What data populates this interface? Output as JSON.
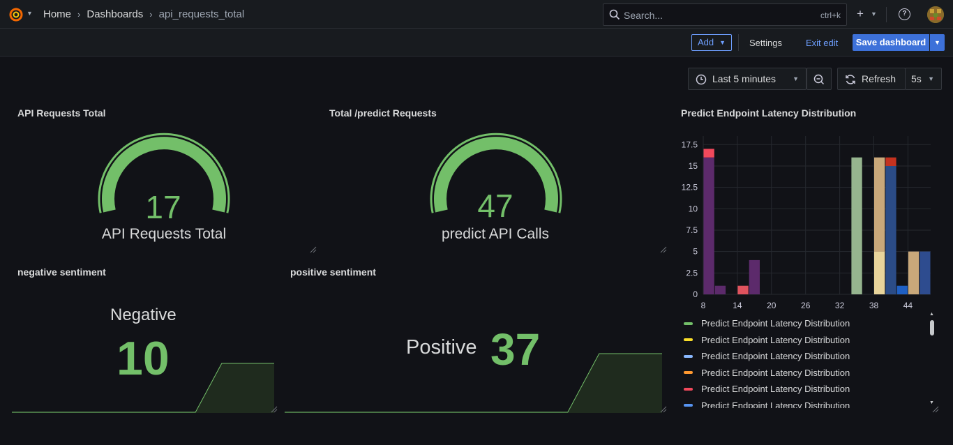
{
  "nav": {
    "breadcrumbs": [
      "Home",
      "Dashboards",
      "api_requests_total"
    ],
    "search_placeholder": "Search...",
    "search_shortcut": "ctrl+k",
    "help_glyph": "?"
  },
  "toolbar": {
    "add_label": "Add",
    "settings_label": "Settings",
    "exit_edit_label": "Exit edit",
    "save_label": "Save dashboard"
  },
  "time": {
    "range_label": "Last 5 minutes",
    "refresh_label": "Refresh",
    "interval_label": "5s"
  },
  "panels": {
    "api_requests": {
      "title": "API Requests Total",
      "value": "17",
      "label": "API Requests Total",
      "fraction": 1.0
    },
    "predict_requests": {
      "title": "Total /predict Requests",
      "value": "47",
      "label": "predict API Calls",
      "fraction": 1.0
    },
    "negative": {
      "title": "negative sentiment",
      "name": "Negative",
      "value": "10"
    },
    "positive": {
      "title": "positive sentiment",
      "name": "Positive",
      "value": "37"
    },
    "latency": {
      "title": "Predict Endpoint Latency Distribution",
      "legend": [
        {
          "label": "Predict Endpoint Latency Distribution",
          "color": "#73bf69"
        },
        {
          "label": "Predict Endpoint Latency Distribution",
          "color": "#fade2a"
        },
        {
          "label": "Predict Endpoint Latency Distribution",
          "color": "#8ab8ff"
        },
        {
          "label": "Predict Endpoint Latency Distribution",
          "color": "#ff9830"
        },
        {
          "label": "Predict Endpoint Latency Distribution",
          "color": "#f2495c"
        },
        {
          "label": "Predict Endpoint Latency Distribution",
          "color": "#5794f2"
        }
      ]
    }
  },
  "chart_data": {
    "type": "bar",
    "title": "Predict Endpoint Latency Distribution",
    "xlabel": "",
    "ylabel": "",
    "xlim": [
      8,
      48
    ],
    "ylim": [
      0,
      18.5
    ],
    "x_ticks": [
      "8",
      "14",
      "20",
      "26",
      "32",
      "38",
      "44"
    ],
    "y_ticks": [
      "0",
      "2.5",
      "5",
      "7.5",
      "10",
      "12.5",
      "15",
      "17.5"
    ],
    "grid": true,
    "legend_position": "bottom",
    "bars": [
      {
        "x0": 8,
        "x1": 10,
        "value": 16,
        "color": "#5c2a6b"
      },
      {
        "x0": 8,
        "x1": 10,
        "value": 1,
        "base": 16,
        "color": "#f2495c"
      },
      {
        "x0": 10,
        "x1": 12,
        "value": 1,
        "color": "#5c2a6b"
      },
      {
        "x0": 14,
        "x1": 16,
        "value": 1,
        "color": "#e0535e"
      },
      {
        "x0": 16,
        "x1": 18,
        "value": 4,
        "color": "#5c2a6b"
      },
      {
        "x0": 34,
        "x1": 36,
        "value": 16,
        "color": "#96b58f"
      },
      {
        "x0": 38,
        "x1": 40,
        "value": 5,
        "color": "#e8d49b"
      },
      {
        "x0": 38,
        "x1": 40,
        "value": 11,
        "base": 5,
        "color": "#c9a87a"
      },
      {
        "x0": 40,
        "x1": 42,
        "value": 15,
        "color": "#2b4c87"
      },
      {
        "x0": 40,
        "x1": 42,
        "value": 1,
        "base": 15,
        "color": "#c4321f"
      },
      {
        "x0": 42,
        "x1": 44,
        "value": 1,
        "color": "#1f60c4"
      },
      {
        "x0": 44,
        "x1": 46,
        "value": 5,
        "color": "#c9a87a"
      },
      {
        "x0": 46,
        "x1": 48,
        "value": 5,
        "color": "#2e4c8f"
      }
    ]
  },
  "sparkline_data": {
    "negative": [
      0,
      0,
      0,
      0,
      0,
      0,
      0,
      0,
      1,
      1,
      1
    ],
    "positive": [
      0,
      0,
      0,
      0,
      0,
      0,
      0,
      0,
      0,
      0,
      1,
      1,
      1
    ]
  },
  "colors": {
    "accent": "#6e9fff",
    "primary": "#3d71d9",
    "gauge": "#73bf69",
    "background": "#111217"
  }
}
